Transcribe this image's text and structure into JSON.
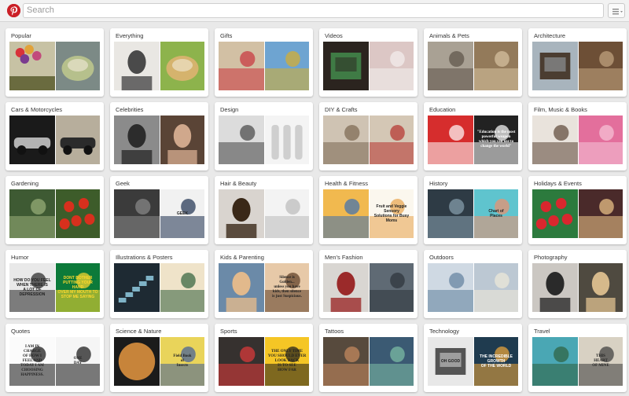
{
  "header": {
    "logo_icon": "pinterest-logo-icon",
    "search_placeholder": "Search",
    "menu_icon": "hamburger-menu-icon"
  },
  "categories": [
    {
      "name": "Popular",
      "images": [
        {
          "bg": "#c7c2a4",
          "fg": "#6a6b3f",
          "style": "balloons"
        },
        {
          "bg": "#7c8a86",
          "fg": "#b6c08c",
          "style": "bowl"
        }
      ]
    },
    {
      "name": "Everything",
      "images": [
        {
          "bg": "#e9e7e3",
          "fg": "#4a4a4a",
          "style": "portrait"
        },
        {
          "bg": "#8db34c",
          "fg": "#d5b36d",
          "style": "cookies"
        }
      ]
    },
    {
      "name": "Gifts",
      "images": [
        {
          "bg": "#d2c0a4",
          "fg": "#c8333c",
          "style": "box"
        },
        {
          "bg": "#6ea4d1",
          "fg": "#d8ae2b",
          "style": "pencils"
        }
      ]
    },
    {
      "name": "Videos",
      "images": [
        {
          "bg": "#2b241f",
          "fg": "#3f7b45",
          "style": "tv"
        },
        {
          "bg": "#dcc7c5",
          "fg": "#f3f0ee",
          "style": "dress"
        }
      ]
    },
    {
      "name": "Animals & Pets",
      "images": [
        {
          "bg": "#a9a194",
          "fg": "#5c5247",
          "style": "cat"
        },
        {
          "bg": "#937a5a",
          "fg": "#d9c5a3",
          "style": "meerkats"
        }
      ]
    },
    {
      "name": "Architecture",
      "images": [
        {
          "bg": "#a8b4bd",
          "fg": "#4b3d31",
          "style": "building"
        },
        {
          "bg": "#6d4f36",
          "fg": "#c5a781",
          "style": "wood"
        }
      ]
    },
    {
      "name": "Cars & Motorcycles",
      "images": [
        {
          "bg": "#1a1a1a",
          "fg": "#b3b3b3",
          "style": "car"
        },
        {
          "bg": "#b7ae9c",
          "fg": "#2b2b2b",
          "style": "bike"
        }
      ]
    },
    {
      "name": "Celebrities",
      "images": [
        {
          "bg": "#8b8b8b",
          "fg": "#2c2c2c",
          "style": "face"
        },
        {
          "bg": "#5a4436",
          "fg": "#d0a88c",
          "style": "face"
        }
      ]
    },
    {
      "name": "Design",
      "images": [
        {
          "bg": "#dcdcdc",
          "fg": "#444444",
          "style": "letter"
        },
        {
          "bg": "#f4f4f4",
          "fg": "#cfcfcf",
          "style": "bottles"
        }
      ]
    },
    {
      "name": "DIY & Crafts",
      "images": [
        {
          "bg": "#cfc3b3",
          "fg": "#7a6650",
          "style": "crafts"
        },
        {
          "bg": "#d4c7b5",
          "fg": "#b5322c",
          "style": "grid"
        }
      ]
    },
    {
      "name": "Education",
      "images": [
        {
          "bg": "#d62d2d",
          "fg": "#ffffff",
          "style": "table"
        },
        {
          "bg": "#222222",
          "fg": "#ffffff",
          "style": "quote",
          "caption": "\"Education is the most\npowerful weapon\nwhich you can use to\nchange the world\""
        }
      ]
    },
    {
      "name": "Film, Music & Books",
      "images": [
        {
          "bg": "#e9e3dc",
          "fg": "#5b4636",
          "style": "books"
        },
        {
          "bg": "#e36f9c",
          "fg": "#f6c4d8",
          "style": "collage"
        }
      ]
    },
    {
      "name": "Gardening",
      "images": [
        {
          "bg": "#3e5a33",
          "fg": "#9bb07a",
          "style": "garden"
        },
        {
          "bg": "#3d5c2a",
          "fg": "#d7301d",
          "style": "tomatoes"
        }
      ]
    },
    {
      "name": "Geek",
      "images": [
        {
          "bg": "#3b3b3b",
          "fg": "#8b8b8b",
          "style": "vader"
        },
        {
          "bg": "#f1f1f1",
          "fg": "#1d2f4e",
          "style": "sweater",
          "caption": "GEEK"
        }
      ]
    },
    {
      "name": "Hair & Beauty",
      "images": [
        {
          "bg": "#d9d4cf",
          "fg": "#3a2818",
          "style": "hair"
        },
        {
          "bg": "#f3f3f3",
          "fg": "#b9b9b9",
          "style": "brush"
        }
      ]
    },
    {
      "name": "Health & Fitness",
      "images": [
        {
          "bg": "#f1b94f",
          "fg": "#3a6fb3",
          "style": "yoga"
        },
        {
          "bg": "#fbf7ee",
          "fg": "#e8a24a",
          "style": "juices",
          "caption": "Fruit and Veggie Sensory\nSolutions for Busy Moms"
        }
      ]
    },
    {
      "name": "History",
      "images": [
        {
          "bg": "#2e3b45",
          "fg": "#8aa3b1",
          "style": "photo"
        },
        {
          "bg": "#5fc4ce",
          "fg": "#f28e6b",
          "style": "map",
          "caption": "Chart of\nPlaces"
        }
      ]
    },
    {
      "name": "Holidays & Events",
      "images": [
        {
          "bg": "#2c7a3d",
          "fg": "#d9272e",
          "style": "apples"
        },
        {
          "bg": "#4a2a2a",
          "fg": "#f1c98b",
          "style": "sparkle"
        }
      ]
    },
    {
      "name": "Humor",
      "images": [
        {
          "bg": "#e9e9e9",
          "fg": "#222222",
          "style": "sign",
          "caption": "HOW DO YOU FEEL\nWHEN THERE IS\nA LOT OF\nDEPRESSION"
        },
        {
          "bg": "#0c7a3a",
          "fg": "#ffd92e",
          "style": "poster",
          "caption": "DONT BOTHER\nPUTTING YOUR HAND\nOVER MY MOUTH TO\nSTOP ME SAYING"
        }
      ]
    },
    {
      "name": "Illustrations & Posters",
      "images": [
        {
          "bg": "#1e2a33",
          "fg": "#7fb3c7",
          "style": "stairs"
        },
        {
          "bg": "#efe3c9",
          "fg": "#2f5f3a",
          "style": "plants"
        }
      ]
    },
    {
      "name": "Kids & Parenting",
      "images": [
        {
          "bg": "#6b8aa8",
          "fg": "#e2b98c",
          "style": "kid"
        },
        {
          "bg": "#e7c9a8",
          "fg": "#5b3a22",
          "style": "quote",
          "caption": "Silence is\nGolden...\nunless you have\nkids, then silence\nis just Suspicious."
        }
      ]
    },
    {
      "name": "Men's Fashion",
      "images": [
        {
          "bg": "#d9d6d2",
          "fg": "#9b2a2a",
          "style": "man"
        },
        {
          "bg": "#5f6a74",
          "fg": "#2c333b",
          "style": "suit"
        }
      ]
    },
    {
      "name": "Outdoors",
      "images": [
        {
          "bg": "#cfd9e3",
          "fg": "#5f7f9c",
          "style": "lake"
        },
        {
          "bg": "#bcc8d3",
          "fg": "#f0ead9",
          "style": "winter"
        }
      ]
    },
    {
      "name": "Photography",
      "images": [
        {
          "bg": "#cbc7c2",
          "fg": "#2a2a2a",
          "style": "couple"
        },
        {
          "bg": "#4f4a40",
          "fg": "#d6b98b",
          "style": "portrait"
        }
      ]
    },
    {
      "name": "Quotes",
      "images": [
        {
          "bg": "#fbfbfb",
          "fg": "#111111",
          "style": "quote",
          "caption": "I AM IN\nCHARGE\nOF HOW I\nFEEL AND\nTODAY I AM\nCHOOSING\nHAPPINESS."
        },
        {
          "bg": "#f5f5f5",
          "fg": "#111111",
          "style": "quote",
          "caption": "ONE\nDAY"
        }
      ]
    },
    {
      "name": "Science & Nature",
      "images": [
        {
          "bg": "#1b1b1b",
          "fg": "#c7843a",
          "style": "venus"
        },
        {
          "bg": "#e9d45a",
          "fg": "#3f5d9b",
          "style": "book",
          "caption": "Field Book\nof\nInsects"
        }
      ]
    },
    {
      "name": "Sports",
      "images": [
        {
          "bg": "#36312f",
          "fg": "#e33b3b",
          "style": "players"
        },
        {
          "bg": "#f5c625",
          "fg": "#1b1b1b",
          "style": "quote",
          "caption": "THE ONLY TIME\nYOU SHOULD EVER\nLOOK BACK\nIS TO SEE\nHOW FAR"
        }
      ]
    },
    {
      "name": "Tattoos",
      "images": [
        {
          "bg": "#574a3d",
          "fg": "#c98b5f",
          "style": "arm"
        },
        {
          "bg": "#3b5a73",
          "fg": "#7fc0a6",
          "style": "back"
        }
      ]
    },
    {
      "name": "Technology",
      "images": [
        {
          "bg": "#e8e8e8",
          "fg": "#555555",
          "style": "radio",
          "caption": "OH GOOD"
        },
        {
          "bg": "#1f3b4f",
          "fg": "#f2a93a",
          "style": "infographic",
          "caption": "THE INCREDIBLE GROWTH\nOF THE WORLD"
        }
      ]
    },
    {
      "name": "Travel",
      "images": [
        {
          "bg": "#4aa7b4",
          "fg": "#2d5f3d",
          "style": "bay"
        },
        {
          "bg": "#d8d1c3",
          "fg": "#3a3a3a",
          "style": "quote",
          "caption": "THIS\nHEART\nOF MINE"
        }
      ]
    }
  ],
  "colors": {
    "accent": "#cb2027",
    "page_bg": "#e9e9e9",
    "card_bg": "#ffffff"
  }
}
